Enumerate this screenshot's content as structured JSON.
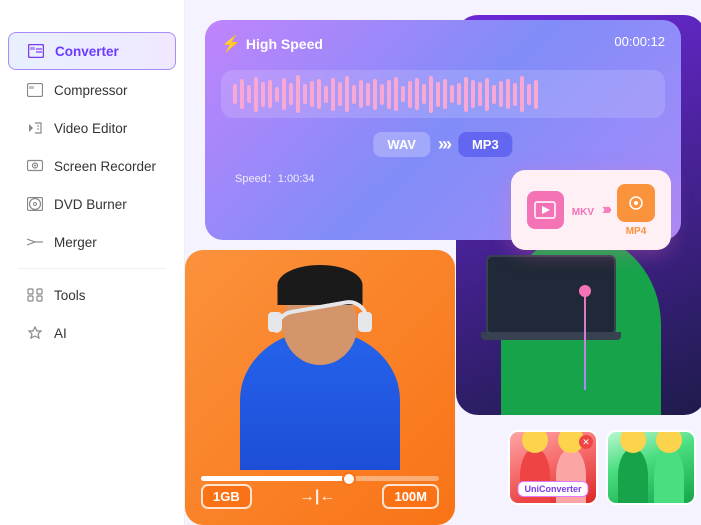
{
  "sidebar": {
    "items": [
      {
        "id": "converter",
        "label": "Converter",
        "active": true
      },
      {
        "id": "compressor",
        "label": "Compressor",
        "active": false
      },
      {
        "id": "video-editor",
        "label": "Video Editor",
        "active": false
      },
      {
        "id": "screen-recorder",
        "label": "Screen Recorder",
        "active": false
      },
      {
        "id": "dvd-burner",
        "label": "DVD Burner",
        "active": false
      },
      {
        "id": "merger",
        "label": "Merger",
        "active": false
      },
      {
        "id": "tools",
        "label": "Tools",
        "active": false
      },
      {
        "id": "ai",
        "label": "AI",
        "active": false
      }
    ]
  },
  "main": {
    "speed_badge": "High Speed",
    "timer": "00:00:12",
    "format_from": "WAV",
    "format_to": "MP3",
    "speed_label": "Speed：1:00:34",
    "mkv_format": "MKV",
    "mp4_format": "MP4",
    "size_from": "1GB",
    "size_to": "100M",
    "brand_label": "UniConverter"
  },
  "colors": {
    "accent_purple": "#7c3aed",
    "accent_pink": "#f472b6",
    "accent_orange": "#f97316",
    "active_bg": "#ede9fe"
  }
}
